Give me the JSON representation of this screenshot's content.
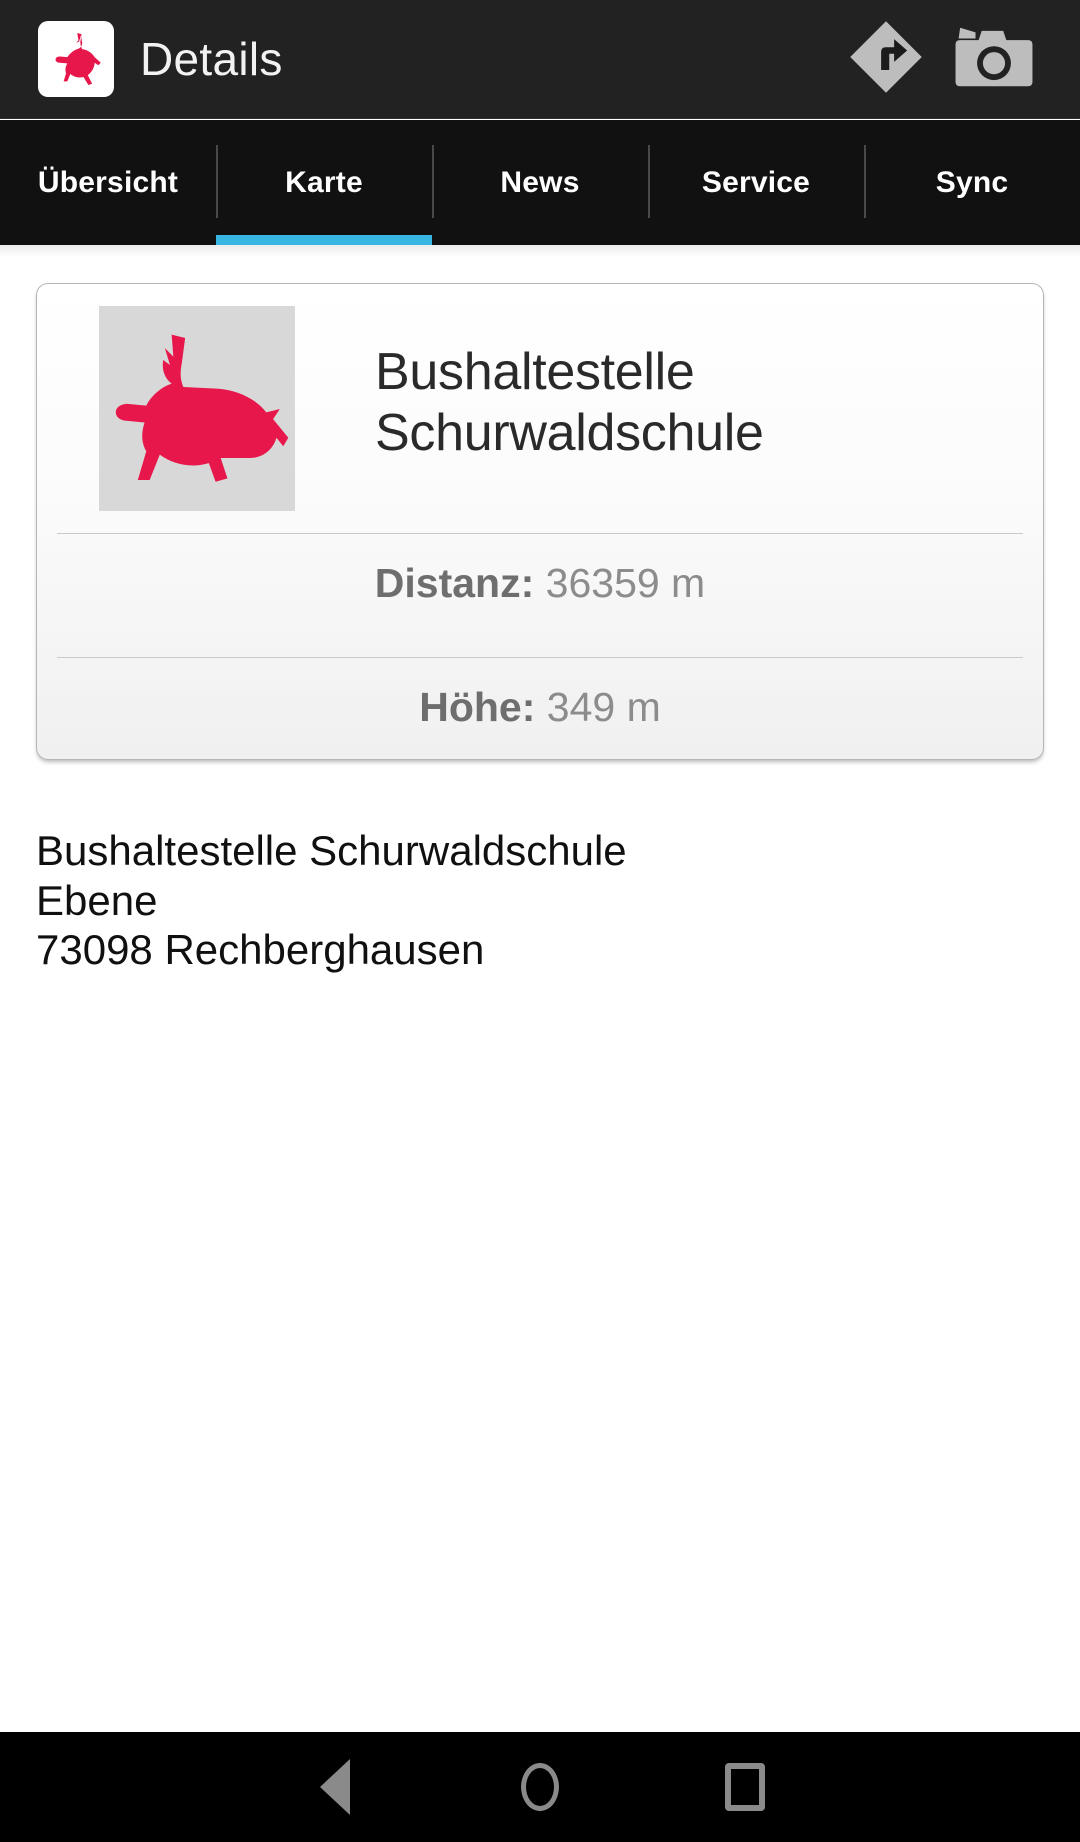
{
  "actionbar": {
    "app_logo_icon": "deer-logo-icon",
    "title": "Details",
    "actions": [
      {
        "icon": "navigation-turn-right-icon",
        "name": "navigate"
      },
      {
        "icon": "camera-icon",
        "name": "camera"
      }
    ]
  },
  "tabs": [
    {
      "label": "Übersicht",
      "active": false
    },
    {
      "label": "Karte",
      "active": true
    },
    {
      "label": "News",
      "active": false
    },
    {
      "label": "Service",
      "active": false
    },
    {
      "label": "Sync",
      "active": false
    }
  ],
  "card": {
    "thumbnail_icon": "deer-logo-icon",
    "title": "Bushaltestelle Schurwaldschule",
    "rows": [
      {
        "key": "Distanz:",
        "value": "36359 m"
      },
      {
        "key": "Höhe:",
        "value": "349 m"
      }
    ]
  },
  "address": {
    "lines": [
      "Bushaltestelle Schurwaldschule",
      "Ebene",
      "73098 Rechberghausen"
    ]
  },
  "navbar": {
    "buttons": [
      {
        "name": "back",
        "icon": "triangle-back-icon"
      },
      {
        "name": "home",
        "icon": "circle-home-icon"
      },
      {
        "name": "recents",
        "icon": "square-recents-icon"
      }
    ]
  },
  "colors": {
    "accent": "#37b6e3",
    "brand_red": "#e8174b",
    "actionbar_bg": "#222222",
    "tabbar_bg": "#111111",
    "navbar_bg": "#000000"
  }
}
